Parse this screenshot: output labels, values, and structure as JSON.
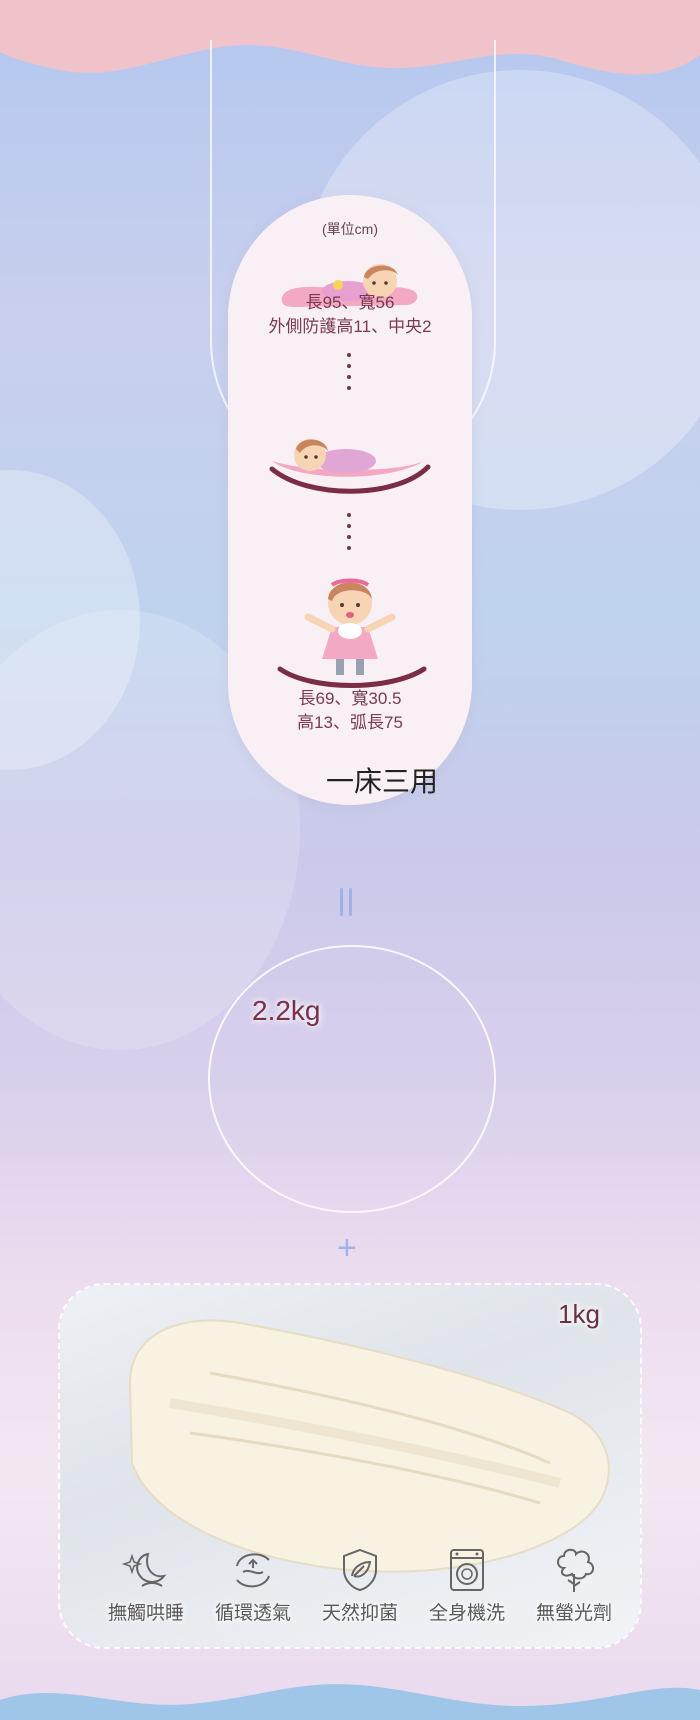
{
  "colors": {
    "accent": "#7a3a50",
    "wave": "#f0c3cb",
    "line_blue": "#9fb2ea"
  },
  "sizes": {
    "unit": "(單位cm)",
    "bed_line1": "長95、寬56",
    "bed_line2": "外側防護高11、中央2",
    "rocker_line1": "長69、寬30.5",
    "rocker_line2": "高13、弧長75"
  },
  "caption": "一床三用",
  "weights": {
    "main": "2.2kg",
    "pad": "1kg"
  },
  "features": [
    {
      "label": "撫觸哄睡",
      "icon": "moon-stars-icon"
    },
    {
      "label": "循環透氣",
      "icon": "airflow-icon"
    },
    {
      "label": "天然抑菌",
      "icon": "shield-leaf-icon"
    },
    {
      "label": "全身機洗",
      "icon": "washing-machine-icon"
    },
    {
      "label": "無螢光劑",
      "icon": "cotton-icon"
    }
  ]
}
